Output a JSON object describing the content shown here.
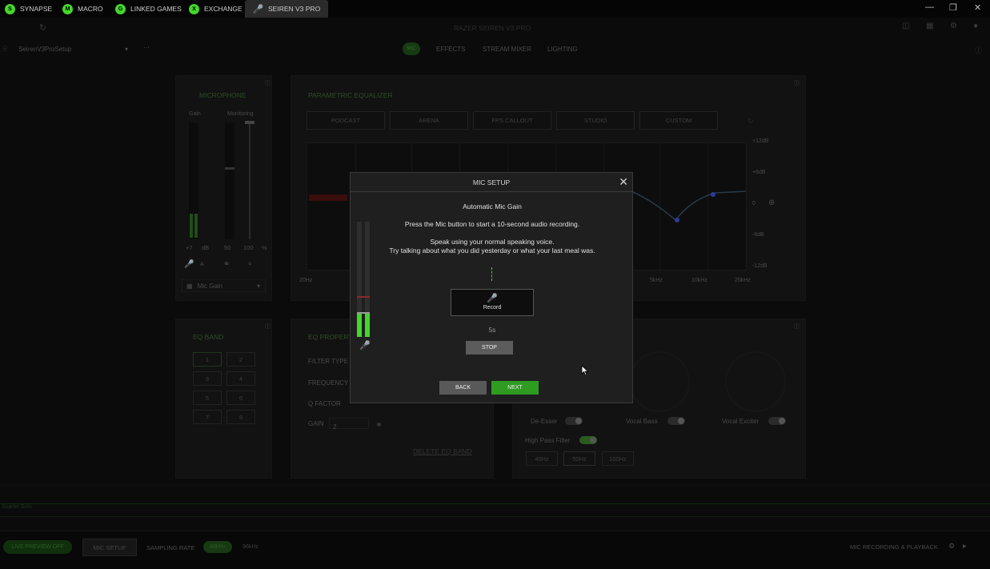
{
  "tabs": [
    {
      "label": "SYNAPSE",
      "icon": "S"
    },
    {
      "label": "MACRO",
      "icon": "M"
    },
    {
      "label": "LINKED GAMES",
      "icon": "G"
    },
    {
      "label": "EXCHANGE",
      "icon": "X"
    },
    {
      "label": "SEIREN V3 PRO",
      "icon": "mic"
    }
  ],
  "window": {
    "title": "RAZER SEIREN V3 PRO"
  },
  "profile": {
    "name": "SeirenV3ProSetup"
  },
  "subnav": [
    "MIC",
    "EFFECTS",
    "STREAM MIXER",
    "LIGHTING"
  ],
  "microphone": {
    "title": "MICROPHONE",
    "gain_label": "Gain",
    "monitoring_label": "Monitoring",
    "gain_value": "+7",
    "gain_unit": "dB",
    "monitoring_value": "50",
    "mix_value": "100",
    "mix_unit": "%",
    "mode_label": "A",
    "dropdown": "Mic Gain"
  },
  "eq": {
    "title": "PARAMETRIC EQUALIZER",
    "presets": [
      "PODCAST",
      "ARENA",
      "FPS CALLOUT",
      "STUDIO",
      "CUSTOM"
    ],
    "db_labels": [
      "+12dB",
      "+6dB",
      "0",
      "-6dB",
      "-12dB"
    ],
    "freq_labels": [
      "20Hz",
      "5kHz",
      "10kHz",
      "20kHz"
    ]
  },
  "eq_band": {
    "title": "EQ BAND",
    "bands": [
      "1",
      "2",
      "3",
      "4",
      "5",
      "6",
      "7",
      "8"
    ]
  },
  "eq_properties": {
    "title": "EQ PROPERTIES",
    "filter_type": "FILTER TYPE",
    "frequency": "FREQUENCY",
    "q_factor": "Q FACTOR",
    "gain": "GAIN",
    "gain_value": "2",
    "delete": "DELETE EQ BAND"
  },
  "effects": {
    "de_esser": "De-Esser",
    "vocal_bass": "Vocal Bass",
    "vocal_exciter": "Vocal Exciter",
    "high_pass": "High Pass Filter",
    "hp_options": [
      "40Hz",
      "50Hz",
      "100Hz"
    ]
  },
  "waveform_label": "Scarlet Solo",
  "bottom": {
    "live_preview": "LIVE PREVIEW OFF",
    "mic_setup": "MIC SETUP",
    "sampling_rate": "SAMPLING RATE",
    "rate_48": "48kHz",
    "rate_96": "96kHz",
    "recording": "MIC RECORDING & PLAYBACK"
  },
  "modal": {
    "title": "MIC SETUP",
    "heading": "Automatic Mic Gain",
    "instruction": "Press the Mic button to start a 10-second audio recording.",
    "tip1": "Speak using your normal speaking voice.",
    "tip2": "Try talking about what you did yesterday or what your last meal was.",
    "record_label": "Record",
    "countdown": "5s",
    "stop_label": "STOP",
    "back_label": "BACK",
    "next_label": "NEXT",
    "meter_level_left": 0.2,
    "meter_level_right": 0.2
  },
  "colors": {
    "accent": "#44d62c",
    "modal_bg": "#1f1f1f",
    "background": "#0a0a0a"
  }
}
